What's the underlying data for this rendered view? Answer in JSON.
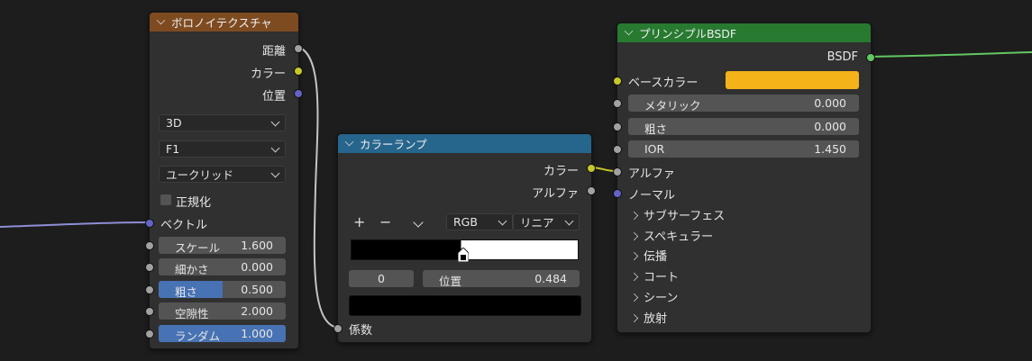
{
  "voronoi": {
    "title": "ボロノイテクスチャ",
    "outputs": [
      "距離",
      "カラー",
      "位置"
    ],
    "dimensions": "3D",
    "feature": "F1",
    "distance": "ユークリッド",
    "normalize_label": "正規化",
    "vector_label": "ベクトル",
    "fields": [
      {
        "label": "スケール",
        "value": "1.600"
      },
      {
        "label": "細かさ",
        "value": "0.000"
      },
      {
        "label": "粗さ",
        "value": "0.500"
      },
      {
        "label": "空隙性",
        "value": "2.000"
      },
      {
        "label": "ランダム",
        "value": "1.000"
      }
    ]
  },
  "colorramp": {
    "title": "カラーランプ",
    "outputs": [
      "カラー",
      "アルファ"
    ],
    "add_label": "+",
    "remove_label": "−",
    "mode": "RGB",
    "interpolation": "リニア",
    "index": "0",
    "position_label": "位置",
    "position_value": "0.484",
    "factor_label": "係数"
  },
  "bsdf": {
    "title": "プリンシプルBSDF",
    "output": "BSDF",
    "base_color_label": "ベースカラー",
    "base_color": "#f5b31a",
    "fields": [
      {
        "label": "メタリック",
        "value": "0.000"
      },
      {
        "label": "粗さ",
        "value": "0.000"
      },
      {
        "label": "IOR",
        "value": "1.450"
      }
    ],
    "alpha_label": "アルファ",
    "normal_label": "ノーマル",
    "panels": [
      "サブサーフェス",
      "スペキュラー",
      "伝播",
      "コート",
      "シーン",
      "放射"
    ]
  },
  "colors": {
    "voronoi_header": "#7e4b21",
    "colorramp_header": "#26658c",
    "bsdf_header": "#277a30",
    "accent": "#4772b3"
  }
}
